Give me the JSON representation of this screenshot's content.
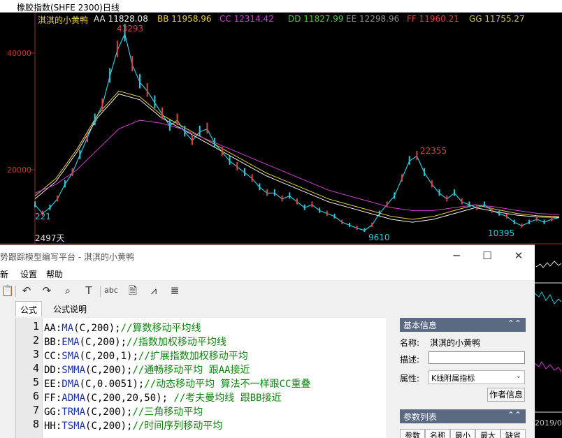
{
  "chart_window": {
    "title": "橡胶指数(SHFE 2300)日线",
    "legend": {
      "indicator_name": "淇淇的小黄鸭",
      "series": [
        {
          "label": "AA 11828.08",
          "color": "#f0f0f0"
        },
        {
          "label": "BB 11958.96",
          "color": "#e8d040"
        },
        {
          "label": "CC 12314.42",
          "color": "#d040d0"
        },
        {
          "label": "DD 11827.99",
          "color": "#40d040"
        },
        {
          "label": "EE 12298.96",
          "color": "#909090"
        },
        {
          "label": "FF 11960.21",
          "color": "#e04040"
        },
        {
          "label": "GG 11755.27",
          "color": "#d0c060"
        }
      ]
    },
    "y_axis_ticks": [
      "40000",
      "20000"
    ],
    "price_labels": {
      "peak_high": "43293",
      "mid_high": "22355",
      "low_1": "9610",
      "low_2": "10395",
      "left_value": "221",
      "bars_count": "2497天"
    },
    "right_edge_label": "2019/0",
    "chart_data": {
      "type": "line",
      "title": "橡胶指数(SHFE 2300)日线",
      "xlabel": "",
      "ylabel": "",
      "ylim": [
        7000,
        48000
      ],
      "y_ticks": [
        20000,
        40000
      ],
      "annotations": [
        {
          "text": "43293",
          "value": 43293
        },
        {
          "text": "22355",
          "value": 22355
        },
        {
          "text": "9610",
          "value": 9610
        },
        {
          "text": "10395",
          "value": 10395
        }
      ],
      "series": [
        {
          "name": "price",
          "color": "#30c8d8",
          "values": [
            14000,
            12500,
            13500,
            15000,
            17500,
            19500,
            22500,
            25500,
            28500,
            31000,
            36000,
            40500,
            43293,
            38000,
            35000,
            33500,
            31500,
            29500,
            27500,
            28500,
            26500,
            25000,
            26500,
            27000,
            24500,
            23000,
            21500,
            20500,
            19500,
            18500,
            17000,
            16000,
            16000,
            15000,
            15500,
            14500,
            13500,
            14000,
            13000,
            12500,
            12000,
            11000,
            10500,
            10000,
            9610,
            10500,
            12500,
            14000,
            15500,
            18500,
            21500,
            22355,
            19500,
            17500,
            16000,
            15000,
            16000,
            14500,
            14000,
            13500,
            14000,
            13000,
            12500,
            12000,
            11000,
            10395,
            11000,
            11500,
            11000,
            11500,
            11800
          ]
        },
        {
          "name": "AA",
          "color": "#f0f0f0",
          "values": [
            15000,
            18000,
            23000,
            29000,
            33000,
            32000,
            29000,
            27000,
            25000,
            23000,
            21000,
            19000,
            17500,
            16000,
            14500,
            13500,
            12500,
            11500,
            11000,
            11500,
            12500,
            13500,
            12800,
            12200,
            11900,
            11828
          ]
        },
        {
          "name": "BB",
          "color": "#e8d040",
          "values": [
            15500,
            18500,
            23500,
            29500,
            33500,
            32500,
            29500,
            27500,
            25500,
            23500,
            21500,
            19500,
            18000,
            16500,
            15000,
            14000,
            13000,
            12000,
            11500,
            12000,
            13000,
            14000,
            13200,
            12500,
            12100,
            11959
          ]
        },
        {
          "name": "CC",
          "color": "#d040d0",
          "values": [
            16000,
            17500,
            20000,
            23500,
            27000,
            28500,
            28000,
            27000,
            25500,
            24000,
            22500,
            21000,
            19500,
            18000,
            16500,
            15500,
            14500,
            13500,
            13000,
            13000,
            13500,
            14000,
            13600,
            13000,
            12500,
            12314
          ]
        }
      ]
    }
  },
  "editor": {
    "title": "势跟踪模型编写平台 - 淇淇的小黄鸭",
    "menu": [
      "新",
      "设置",
      "帮助"
    ],
    "tabs": [
      "公式",
      "公式说明"
    ],
    "code_lines": [
      {
        "num": "1",
        "var": "AA",
        "func": "MA",
        "args": "(C,200);",
        "comment": "//算数移动平均线"
      },
      {
        "num": "2",
        "var": "BB",
        "func": "EMA",
        "args": "(C,200);",
        "comment": "//指数加权移动平均线"
      },
      {
        "num": "3",
        "var": "CC",
        "func": "SMA",
        "args": "(C,200,1);",
        "comment": "//扩展指数加权移动平均"
      },
      {
        "num": "4",
        "var": "DD",
        "func": "SMMA",
        "args": "(C,200);",
        "comment": "//通畅移动平均  跟AA接近"
      },
      {
        "num": "5",
        "var": "EE",
        "func": "DMA",
        "args": "(C,0.0051);",
        "comment": "//动态移动平均 算法不一样跟CC重叠"
      },
      {
        "num": "6",
        "var": "FF",
        "func": "ADMA",
        "args": "(C,200,20,50); ",
        "comment": "//考夫曼均线  跟BB接近"
      },
      {
        "num": "7",
        "var": "GG",
        "func": "TRMA",
        "args": "(C,200);",
        "comment": "//三角移动平均"
      },
      {
        "num": "8",
        "var": "HH",
        "func": "TSMA",
        "args": "(C,200);",
        "comment": "//时间序列移动平均"
      }
    ],
    "basic_info": {
      "header": "基本信息",
      "name_label": "名称:",
      "name_value": "淇淇的小黄鸭",
      "desc_label": "描述:",
      "desc_value": "",
      "attr_label": "属性:",
      "attr_value": "K线附属指标",
      "author_button": "作者信息"
    },
    "param_list": {
      "header": "参数列表",
      "columns": [
        "参数",
        "名称",
        "最小",
        "最大",
        "缺省"
      ]
    }
  }
}
